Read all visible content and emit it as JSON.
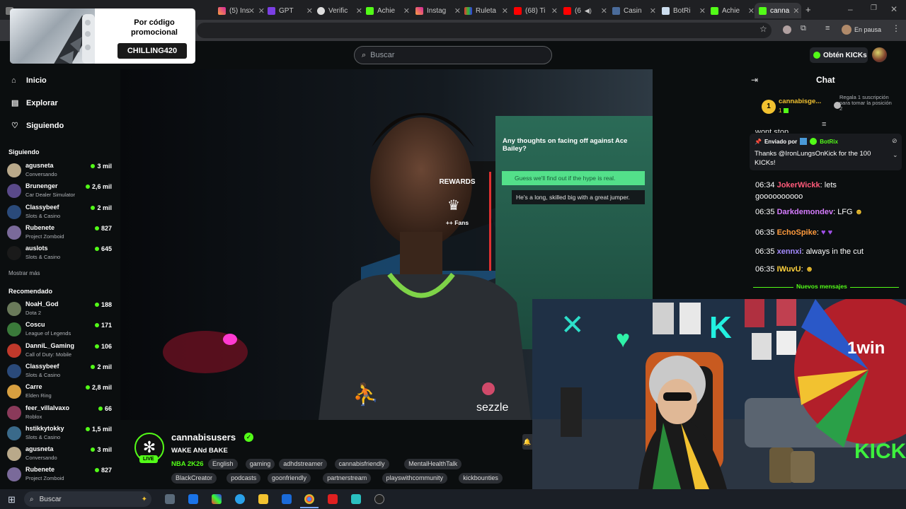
{
  "browser": {
    "tabs": [
      {
        "label": ""
      },
      {
        "label": ""
      },
      {
        "label": ""
      },
      {
        "label": "(5) Ins"
      },
      {
        "label": "GPT"
      },
      {
        "label": "Verific"
      },
      {
        "label": "Achie"
      },
      {
        "label": "Instag"
      },
      {
        "label": "Ruleta"
      },
      {
        "label": "(68) Ti"
      },
      {
        "label": "(6"
      },
      {
        "label": "Casin"
      },
      {
        "label": "BotRi"
      },
      {
        "label": "Achie"
      },
      {
        "label": "canna"
      }
    ],
    "profile_status": "En pausa"
  },
  "promo": {
    "title": "Por código promocional",
    "code": "CHILLING420"
  },
  "header": {
    "search_placeholder": "Buscar",
    "kicks_button": "Obtén KICKs"
  },
  "sidebar": {
    "nav": [
      {
        "label": "Inicio",
        "icon": "home-icon"
      },
      {
        "label": "Explorar",
        "icon": "compass-icon"
      },
      {
        "label": "Siguiendo",
        "icon": "heart-icon"
      }
    ],
    "following_title": "Siguiendo",
    "following": [
      {
        "name": "agusneta",
        "game": "Conversando",
        "viewers": "3 mil"
      },
      {
        "name": "Brunenger",
        "game": "Car Dealer Simulator",
        "viewers": "2,6 mil"
      },
      {
        "name": "Classybeef",
        "game": "Slots & Casino",
        "viewers": "2 mil"
      },
      {
        "name": "Rubenete",
        "game": "Project Zomboid",
        "viewers": "827"
      },
      {
        "name": "auslots",
        "game": "Slots & Casino",
        "viewers": "645"
      }
    ],
    "show_more": "Mostrar más",
    "recommended_title": "Recomendado",
    "recommended": [
      {
        "name": "NoaH_God",
        "game": "Dota 2",
        "viewers": "188"
      },
      {
        "name": "Coscu",
        "game": "League of Legends",
        "viewers": "171"
      },
      {
        "name": "DanniL_Gaming",
        "game": "Call of Duty: Mobile",
        "viewers": "106"
      },
      {
        "name": "Classybeef",
        "game": "Slots & Casino",
        "viewers": "2 mil"
      },
      {
        "name": "Carre",
        "game": "Elden Ring",
        "viewers": "2,8 mil"
      },
      {
        "name": "feer_villalvaxo",
        "game": "Roblox",
        "viewers": "66"
      },
      {
        "name": "hstikkytokky",
        "game": "Slots & Casino",
        "viewers": "1,5 mil"
      },
      {
        "name": "agusneta",
        "game": "Conversando",
        "viewers": "3 mil"
      },
      {
        "name": "Rubenete",
        "game": "Project Zomboid",
        "viewers": "827"
      }
    ]
  },
  "stream": {
    "question": "Any thoughts on facing off against Ace Bailey?",
    "answer_1": "Guess we'll find out if the hype is real.",
    "answer_2": "He's a long, skilled big with a great jumper.",
    "rewards_label": "REWARDS",
    "rewards_sub": "++ Fans",
    "jersey_sponsor": "sezzle"
  },
  "channel": {
    "name": "cannabisusers",
    "live_badge": "LIVE",
    "title": "WAKE ANd BAKE",
    "category": "NBA 2K26",
    "tags": [
      "English",
      "gaming",
      "adhdstreamer",
      "cannabisfriendly",
      "MentalHealthTalk",
      "BlackCreator",
      "podcasts",
      "goonfriendly",
      "partnerstream",
      "playswithcommunity",
      "kickbounties"
    ]
  },
  "chat": {
    "title": "Chat",
    "leader_rank": "1",
    "leader_name": "cannabisge...",
    "leader_count": "1",
    "gift_text": "Regala 1 suscripción para tomar la posición 2",
    "truncated_msg": "wont stop",
    "pinned_sender_prefix": "Enviado por",
    "pinned_sender": "BotRix",
    "pinned_text": "Thanks @IronLungsOnKick for the 100 KICKs!",
    "messages": [
      {
        "time": "06:34",
        "user": "JokerWickk",
        "color": "#ff5a7a",
        "text": ": lets",
        "text2": "goooooooooo"
      },
      {
        "time": "06:35",
        "user": "Darkdemondev",
        "color": "#d67cff",
        "text": ": LFG"
      },
      {
        "time": "06:35",
        "user": "EchoSpike",
        "color": "#ff9b3d",
        "text": ":"
      },
      {
        "time": "06:35",
        "user": "xennxi",
        "color": "#a48bff",
        "text": ": always in the cut"
      },
      {
        "time": "06:35",
        "user": "IWuvU",
        "color": "#ffd23d",
        "text": ":"
      }
    ],
    "new_messages": "Nuevos mensajes"
  },
  "taskbar": {
    "search_placeholder": "Buscar"
  },
  "colors": {
    "kick_green": "#53fc18",
    "background": "#0b0e0f"
  }
}
